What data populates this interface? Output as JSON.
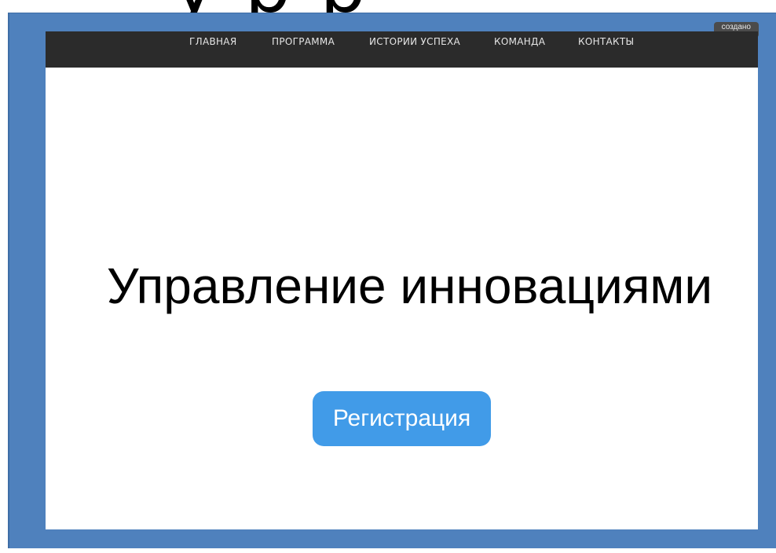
{
  "slide": {
    "title_fragment": "у          р   р"
  },
  "badge": {
    "label": "создано"
  },
  "nav": {
    "items": [
      {
        "label": "ГЛАВНАЯ"
      },
      {
        "label": "ПРОГРАММА"
      },
      {
        "label": "ИСТОРИИ УСПЕХА"
      },
      {
        "label": "КОМАНДА"
      },
      {
        "label": "КОНТАКТЫ"
      }
    ]
  },
  "hero": {
    "title": "Управление инновациями",
    "register_label": "Регистрация"
  },
  "colors": {
    "frame": "#4f81bd",
    "navbar": "#2b2b2b",
    "button": "#419be8"
  }
}
